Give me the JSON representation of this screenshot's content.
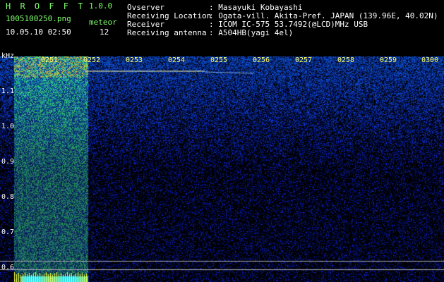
{
  "header": {
    "app_title": "H R O F F T",
    "app_version": "1.0.0",
    "filename": "1005100250.png",
    "datetime": "10.05.10 02:50",
    "meteor_label": "meteor",
    "meteor_count": "12",
    "info": [
      {
        "key": "Ovserver",
        "value": ": Masayuki Kobayashi"
      },
      {
        "key": "Receiving Location",
        "value": ": Ogata-vill. Akita-Pref. JAPAN (139.96E, 40.02N)"
      },
      {
        "key": "Receiver",
        "value": ": ICOM IC-575 53.7492(@LCD)MHz USB"
      },
      {
        "key": "Receiving antenna",
        "value": ": A504HB(yagi 4el)"
      }
    ]
  },
  "axes": {
    "y_unit": "kHz",
    "y_ticks": [
      "1.1",
      "1.0",
      "0.9",
      "0.8",
      "0.7",
      "0.6"
    ],
    "time_ticks": [
      "0251",
      "0252",
      "0253",
      "0254",
      "0255",
      "0256",
      "0257",
      "0258",
      "0259",
      "0300"
    ]
  },
  "colors": {
    "header_green": "#7dff6a",
    "time_yellow": "#ffff66",
    "bg_noise": "#10208a"
  }
}
